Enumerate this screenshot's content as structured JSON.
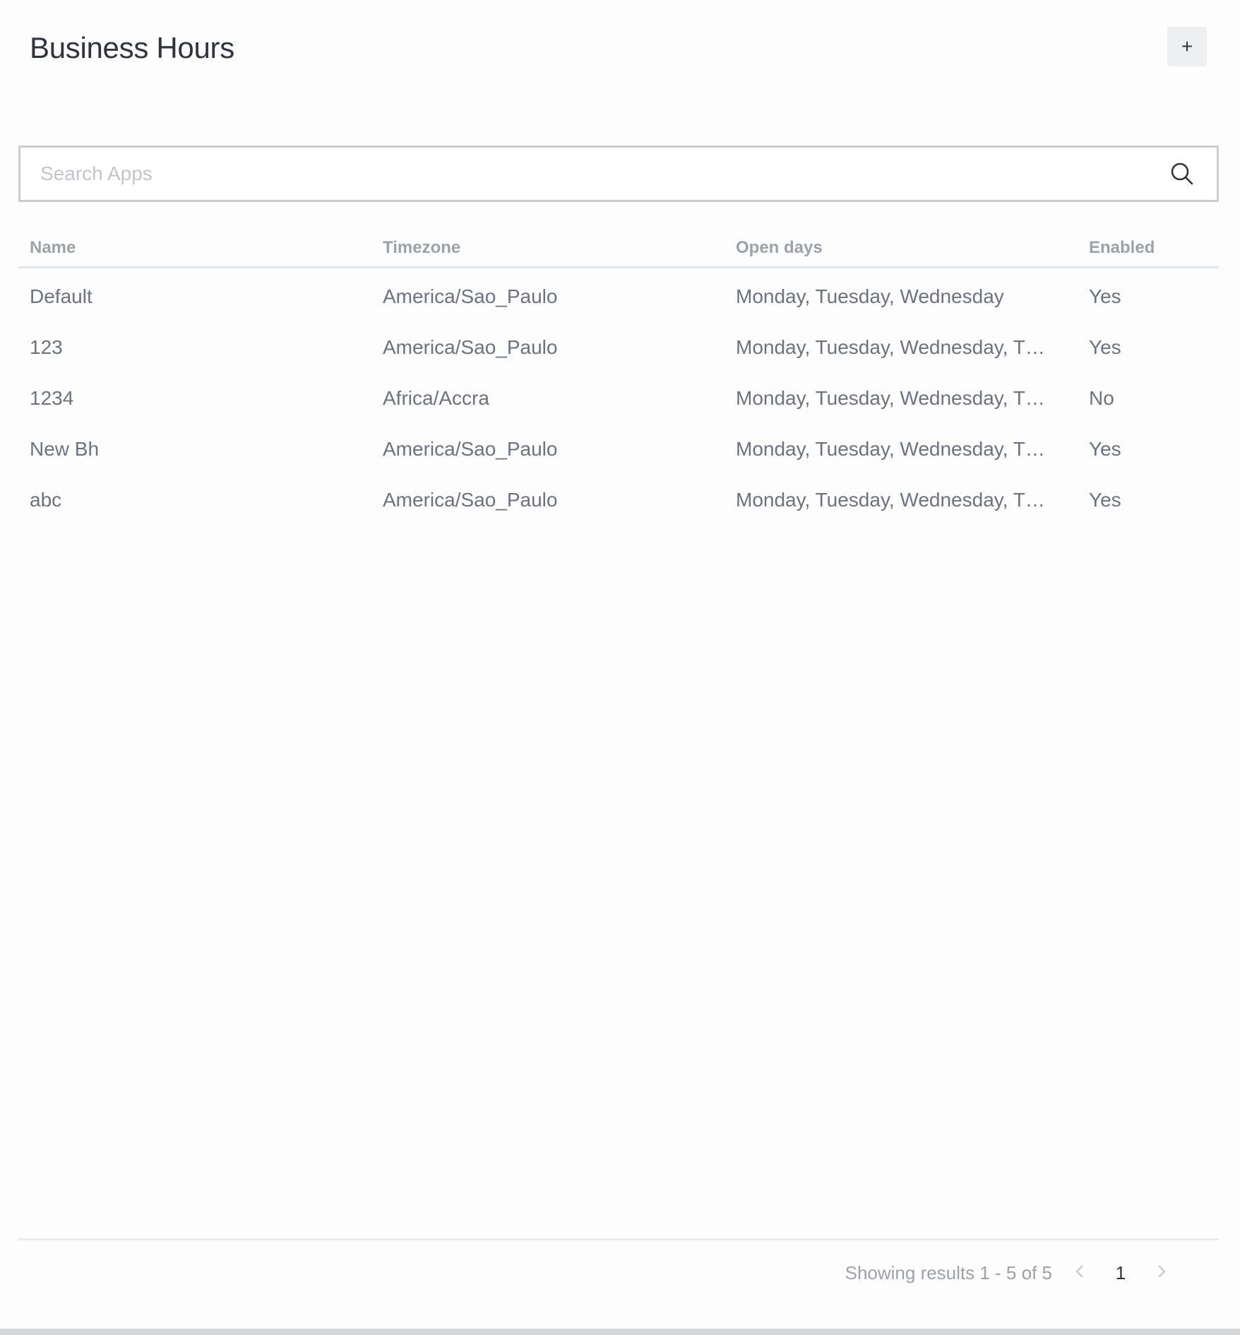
{
  "header": {
    "title": "Business Hours",
    "add_label": "+"
  },
  "search": {
    "placeholder": "Search Apps",
    "value": ""
  },
  "table": {
    "columns": [
      "Name",
      "Timezone",
      "Open days",
      "Enabled"
    ],
    "rows": [
      {
        "name": "Default",
        "timezone": "America/Sao_Paulo",
        "open_days": "Monday, Tuesday, Wednesday",
        "enabled": "Yes"
      },
      {
        "name": "123",
        "timezone": "America/Sao_Paulo",
        "open_days": "Monday, Tuesday, Wednesday, Th...",
        "enabled": "Yes"
      },
      {
        "name": "1234",
        "timezone": "Africa/Accra",
        "open_days": "Monday, Tuesday, Wednesday, Th...",
        "enabled": "No"
      },
      {
        "name": "New Bh",
        "timezone": "America/Sao_Paulo",
        "open_days": "Monday, Tuesday, Wednesday, Th...",
        "enabled": "Yes"
      },
      {
        "name": "abc",
        "timezone": "America/Sao_Paulo",
        "open_days": "Monday, Tuesday, Wednesday, Th...",
        "enabled": "Yes"
      }
    ]
  },
  "pagination": {
    "results_text": "Showing results 1 - 5 of 5",
    "current_page": "1",
    "prev_icon": "chevron-left-icon",
    "next_icon": "chevron-right-icon"
  },
  "colors": {
    "title": "#2f343d",
    "text": "#6c737f",
    "muted": "#9ea2a8",
    "border": "#cbced1"
  }
}
